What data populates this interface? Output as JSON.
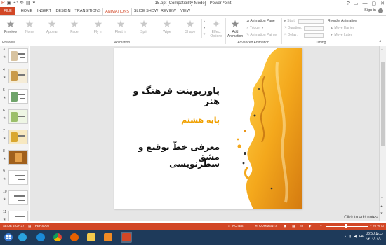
{
  "window": {
    "title": "15.ppt [Compatibility Mode] - PowerPoint",
    "controls": [
      "?",
      "▭",
      "—",
      "▢",
      "✕"
    ]
  },
  "ribbon_tabs": {
    "file": "FILE",
    "items": [
      "HOME",
      "INSERT",
      "DESIGN",
      "TRANSITIONS",
      "ANIMATIONS",
      "SLIDE SHOW",
      "REVIEW",
      "VIEW"
    ],
    "active": "ANIMATIONS",
    "sign_in": "Sign in"
  },
  "ribbon": {
    "preview": "Preview",
    "preview_group": "Preview",
    "animations": [
      "None",
      "Appear",
      "Fade",
      "Fly In",
      "Float In",
      "Split",
      "Wipe",
      "Shape"
    ],
    "effect_options": "Effect Options",
    "animation_group": "Animation",
    "add_animation": "Add Animation",
    "animation_pane": "Animation Pane",
    "trigger": "Trigger",
    "animation_painter": "Animation Painter",
    "advanced_group": "Advanced Animation",
    "start": "Start:",
    "duration": "Duration:",
    "delay": "Delay:",
    "timing_group": "Timing",
    "reorder": "Reorder Animation",
    "move_earlier": "Move Earlier",
    "move_later": "Move Later"
  },
  "thumbnails": {
    "slides": [
      "3",
      "4",
      "5",
      "6",
      "7",
      "8",
      "9",
      "10",
      "11"
    ],
    "selected": "2"
  },
  "slide": {
    "title": "پاورپوینت فرهنگ و هنر",
    "grade": "پایه هشتم",
    "subject_line1": "معرفی خطّ توقیع و مشق",
    "subject_line2": "سطرنویسی",
    "title_color": "#111111",
    "grade_color": "#f0a000"
  },
  "notes": {
    "placeholder": "Click to add notes"
  },
  "status": {
    "slide_info": "SLIDE 2 OF 37",
    "language": "PERSIAN",
    "notes": "NOTES",
    "comments": "COMMENTS",
    "zoom": "70 %",
    "accent": "#d24726"
  },
  "taskbar": {
    "time": "03:50 ب.ظ",
    "date": "۱۴۰۱/۰۱/۱۱",
    "lang": "FA"
  }
}
